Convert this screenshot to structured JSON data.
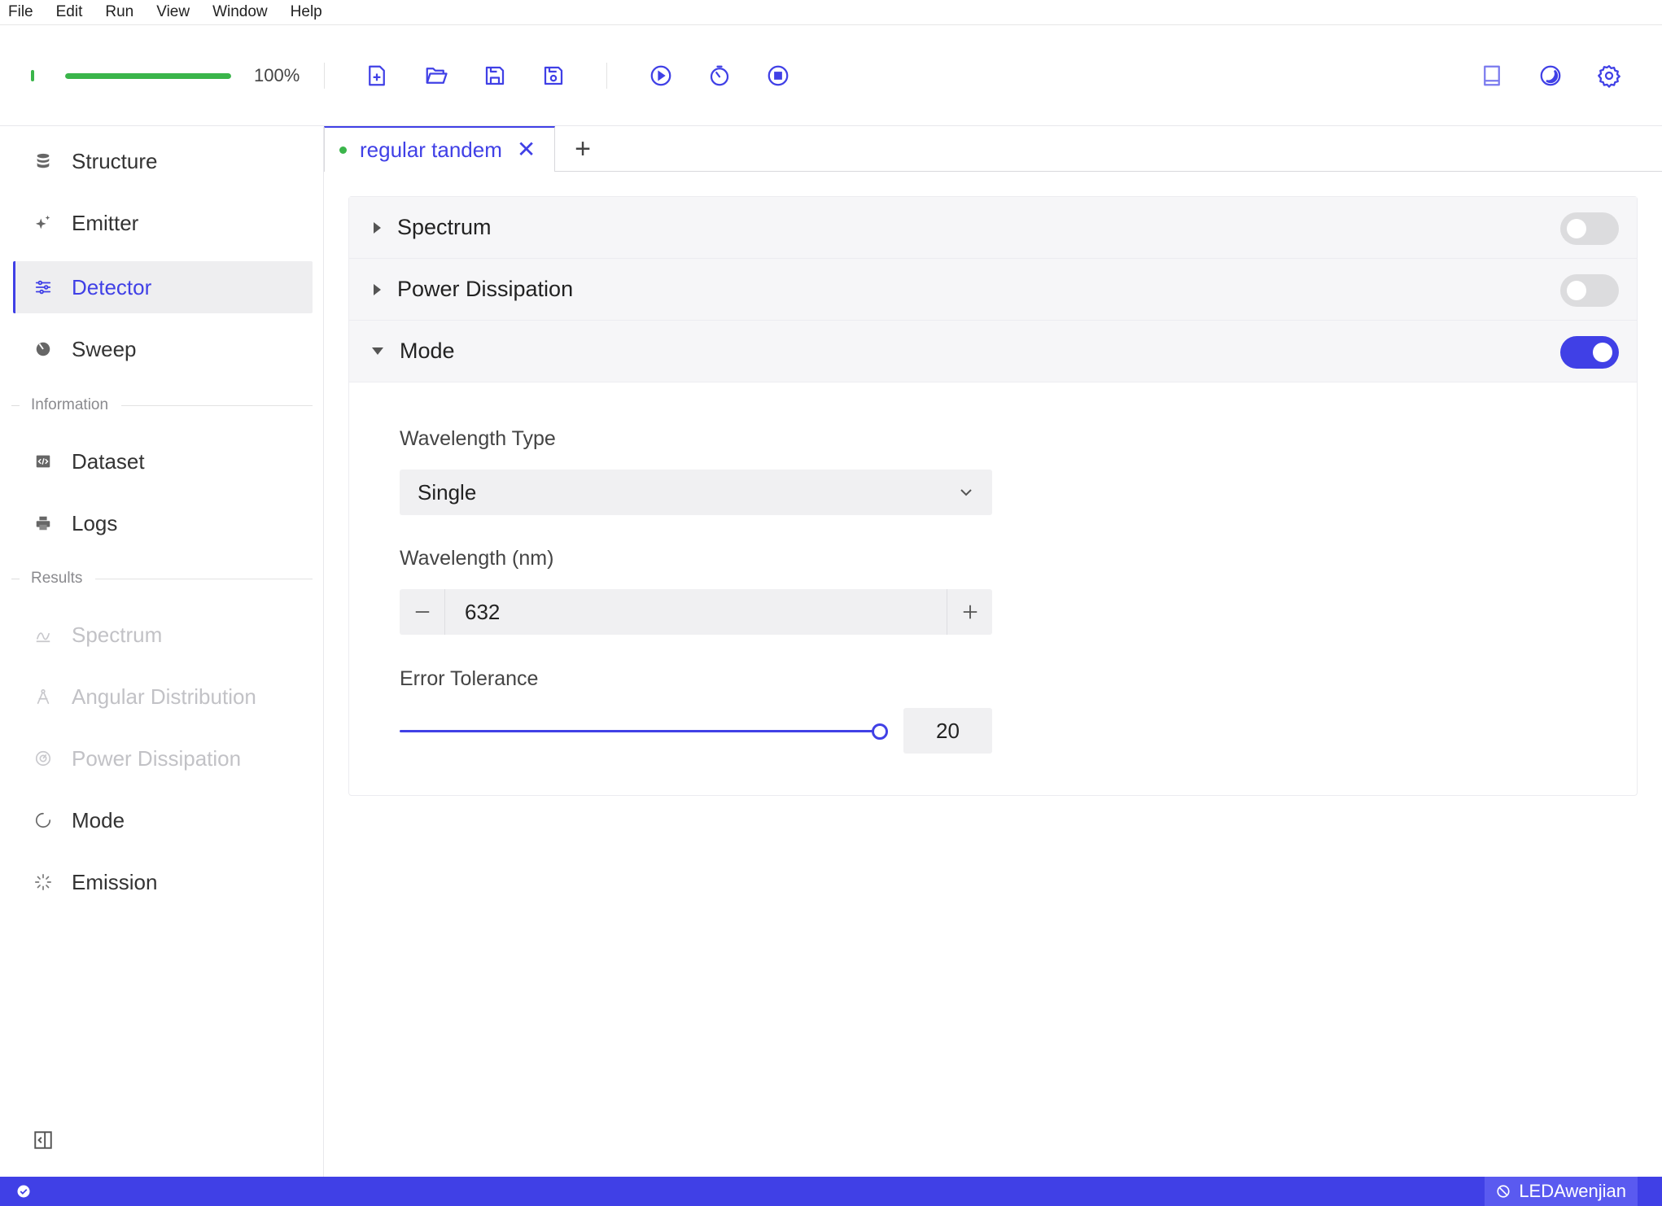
{
  "menu": [
    "File",
    "Edit",
    "Run",
    "View",
    "Window",
    "Help"
  ],
  "toolbar": {
    "progress_value": 1.0,
    "progress_text": "100%",
    "status_color": "#3ab54a",
    "accent": "#4040e6",
    "icons": [
      "new-file-icon",
      "open-folder-icon",
      "save-icon",
      "save-as-icon",
      "run-icon",
      "timer-icon",
      "stop-icon",
      "book-icon",
      "theme-icon",
      "settings-icon"
    ]
  },
  "sidebar": {
    "items": [
      {
        "label": "Structure",
        "icon": "database-icon"
      },
      {
        "label": "Emitter",
        "icon": "sparkle-icon"
      },
      {
        "label": "Detector",
        "icon": "sliders-icon",
        "active": true
      },
      {
        "label": "Sweep",
        "icon": "pie-icon"
      }
    ],
    "info_header": "Information",
    "info_items": [
      {
        "label": "Dataset",
        "icon": "code-icon"
      },
      {
        "label": "Logs",
        "icon": "printer-icon"
      }
    ],
    "results_header": "Results",
    "results_items": [
      {
        "label": "Spectrum",
        "icon": "spectrum-icon",
        "disabled": true
      },
      {
        "label": "Angular Distribution",
        "icon": "compass-icon",
        "disabled": true
      },
      {
        "label": "Power Dissipation",
        "icon": "gauge-icon",
        "disabled": true
      },
      {
        "label": "Mode",
        "icon": "loading-icon"
      },
      {
        "label": "Emission",
        "icon": "spinner-icon"
      }
    ]
  },
  "tabs": {
    "active_label": "regular tandem",
    "close_glyph": "✕",
    "add_glyph": "+"
  },
  "panel": {
    "sections": [
      {
        "title": "Spectrum",
        "enabled": false,
        "expanded": false
      },
      {
        "title": "Power Dissipation",
        "enabled": false,
        "expanded": false
      },
      {
        "title": "Mode",
        "enabled": true,
        "expanded": true
      }
    ],
    "wavelength_type_label": "Wavelength Type",
    "wavelength_type_value": "Single",
    "wavelength_label": "Wavelength (nm)",
    "wavelength_value": "632",
    "error_tolerance_label": "Error Tolerance",
    "error_tolerance_value": "20",
    "error_tolerance_fraction": 1.0
  },
  "statusbar": {
    "user": "LEDAwenjian"
  }
}
